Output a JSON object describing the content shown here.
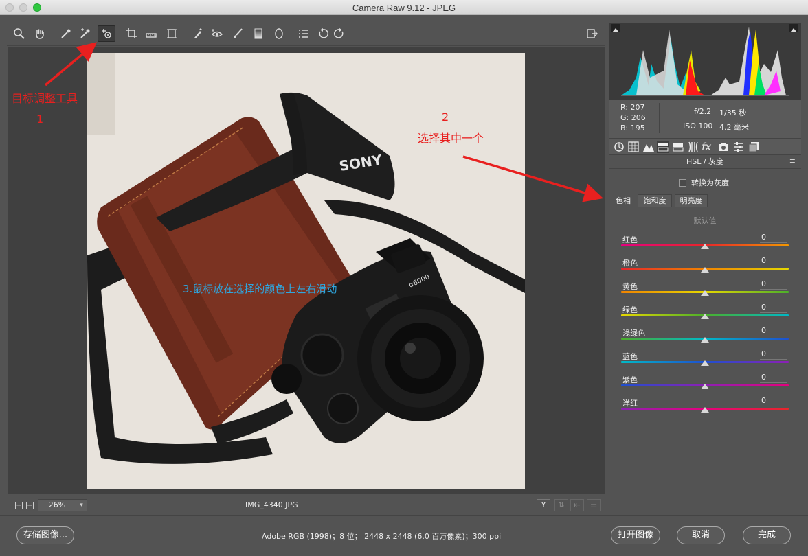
{
  "window": {
    "title": "Camera Raw 9.12 -  JPEG"
  },
  "toolbar": {
    "tools": [
      "zoom-icon",
      "hand-icon",
      "white-balance-icon",
      "color-sampler-icon",
      "targeted-adjustment-icon",
      "crop-icon",
      "straighten-icon",
      "transform-icon",
      "spot-removal-icon",
      "red-eye-icon",
      "adjustment-brush-icon",
      "graduated-filter-icon",
      "radial-filter-icon",
      "preferences-icon",
      "rotate-left-icon",
      "rotate-right-icon"
    ],
    "fullscreen_icon": "fullscreen-toggle-icon"
  },
  "annotations": {
    "tool_name": "目标调整工具",
    "step1": "1",
    "step2_num": "2",
    "step2_text": "选择其中一个",
    "step3_text": "3.鼠标放在选择的颜色上左右滑动"
  },
  "photo": {
    "strap_brand": "SONY",
    "camera_model": "α6000"
  },
  "canvas_bar": {
    "zoom_minus": "−",
    "zoom_plus": "+",
    "zoom": "26%",
    "filename": "IMG_4340.JPG",
    "y_label": "Y"
  },
  "info": {
    "r": "R:  207",
    "g": "G:  206",
    "b": "B:  195",
    "aperture": "f/2.2",
    "shutter": "1/35 秒",
    "iso": "ISO 100",
    "focal": "4.2 毫米"
  },
  "panel": {
    "section_title": "HSL / 灰度",
    "convert_gray": "转换为灰度",
    "tabs": [
      "色相",
      "饱和度",
      "明亮度"
    ],
    "active_tab": "色相",
    "default_link": "默认值",
    "sliders": [
      {
        "label": "红色",
        "value": "0"
      },
      {
        "label": "橙色",
        "value": "0"
      },
      {
        "label": "黄色",
        "value": "0"
      },
      {
        "label": "绿色",
        "value": "0"
      },
      {
        "label": "浅绿色",
        "value": "0"
      },
      {
        "label": "蓝色",
        "value": "0"
      },
      {
        "label": "紫色",
        "value": "0"
      },
      {
        "label": "洋红",
        "value": "0"
      }
    ],
    "slider_gradients": [
      [
        "#e6007e",
        "#e8262a",
        "#f39700"
      ],
      [
        "#e8262a",
        "#f08300",
        "#e6d800"
      ],
      [
        "#f08300",
        "#e6d800",
        "#4caf2a"
      ],
      [
        "#e6d800",
        "#4caf2a",
        "#00b9c6"
      ],
      [
        "#4caf2a",
        "#00b9c6",
        "#1e50d0"
      ],
      [
        "#00b9c6",
        "#1e50d0",
        "#8d1fb5"
      ],
      [
        "#1e50d0",
        "#8d1fb5",
        "#e6007e"
      ],
      [
        "#8d1fb5",
        "#e6007e",
        "#e8262a"
      ]
    ]
  },
  "bottom": {
    "save": "存储图像...",
    "workflow": "Adobe RGB (1998)；8 位；  2448 x 2448 (6.0 百万像素)；300 ppi",
    "open": "打开图像",
    "cancel": "取消",
    "done": "完成"
  },
  "colors": {
    "annotation_red": "#e8201f",
    "annotation_blue": "#2ea7e0",
    "panel_bg": "#535353"
  }
}
